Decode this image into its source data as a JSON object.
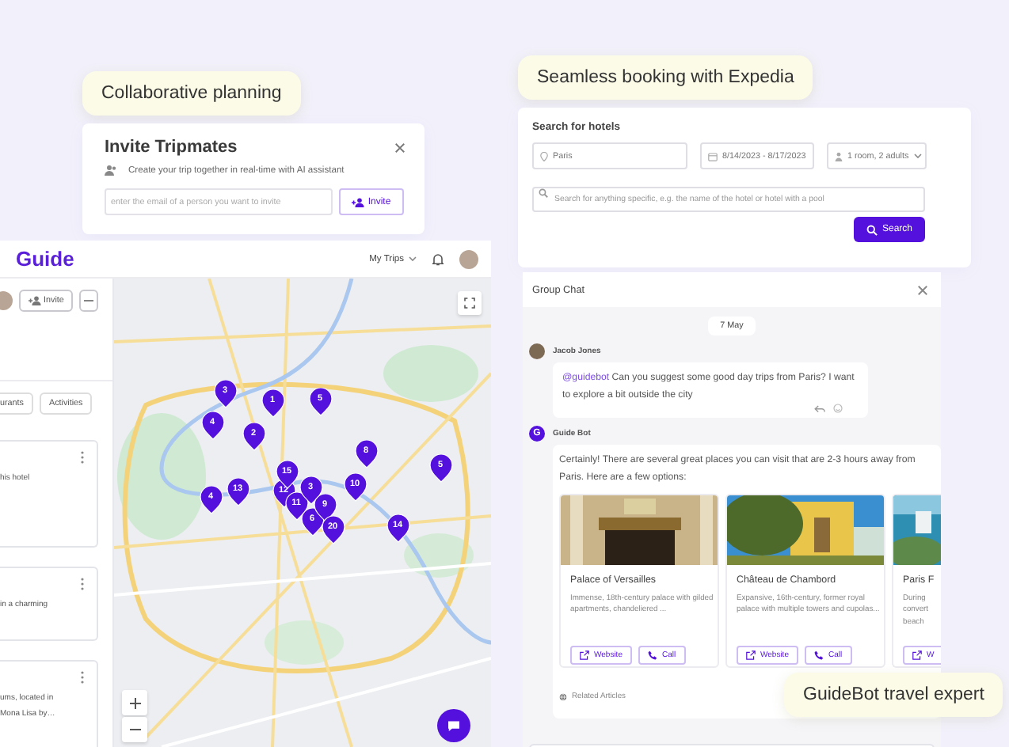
{
  "captions": [
    {
      "text": "Collaborative planning"
    },
    {
      "text": "Seamless booking with Expedia"
    },
    {
      "text": "GuideBot travel expert"
    }
  ],
  "invite": {
    "title": "Invite Tripmates",
    "subtitle": "Create your trip together in real-time with AI assistant",
    "email": {
      "placeholder": "enter the email of a person you want to invite"
    },
    "button": "Invite"
  },
  "app": {
    "logo": "Guide",
    "trips_menu": "My Trips",
    "sidebar": {
      "invite_button": "Invite",
      "tabs": [
        {
          "label": "urants",
          "selected": false
        },
        {
          "label": "Activities",
          "selected": false
        }
      ],
      "cards": [
        {
          "lines": [
            "his hotel"
          ]
        },
        {
          "lines": [
            "in a charming"
          ]
        },
        {
          "lines": [
            "ums, located in",
            "Mona Lisa by…"
          ]
        }
      ]
    },
    "map": {
      "pins": [
        {
          "label": "3"
        },
        {
          "label": "1"
        },
        {
          "label": "5"
        },
        {
          "label": "4"
        },
        {
          "label": "2"
        },
        {
          "label": "8"
        },
        {
          "label": "5"
        },
        {
          "label": "12"
        },
        {
          "label": "11"
        },
        {
          "label": "6"
        },
        {
          "label": "15"
        },
        {
          "label": "3"
        },
        {
          "label": "10"
        },
        {
          "label": "4"
        },
        {
          "label": "13"
        },
        {
          "label": "9"
        },
        {
          "label": "20"
        },
        {
          "label": "14"
        }
      ]
    }
  },
  "hotels": {
    "title": "Search for hotels",
    "destination": "Paris",
    "dates": "8/14/2023 - 8/17/2023",
    "guests": "1 room, 2 adults",
    "query": {
      "placeholder": "Search for anything specific, e.g. the name of the hotel or hotel with a pool"
    },
    "button": "Search"
  },
  "chat": {
    "title": "Group Chat",
    "date": "7 May",
    "messages": [
      {
        "kind": "user",
        "author": "Jacob Jones",
        "mention": "@guidebot",
        "text": "Can you suggest some good day trips from Paris? I want to explore a bit outside the city"
      },
      {
        "kind": "bot",
        "author": "Guide Bot",
        "avatar": "G",
        "text": "Certainly! There are several great places you can visit that are 2-3 hours away from Paris. Here are a few options:",
        "footer": "Related Articles",
        "places": [
          {
            "title": "Palace of Versailles",
            "description": "Immense, 18th-century palace with gilded apartments, chandeliered ...",
            "buttons": [
              {
                "kind": "website",
                "label": "Website"
              },
              {
                "kind": "call",
                "label": "Call"
              }
            ]
          },
          {
            "title": "Château de Chambord",
            "description": "Expansive, 16th-century, former royal palace with multiple towers and cupolas...",
            "buttons": [
              {
                "kind": "website",
                "label": "Website"
              },
              {
                "kind": "call",
                "label": "Call"
              }
            ]
          },
          {
            "title": "Paris F",
            "description": "During convert beach",
            "buttons": [
              {
                "kind": "website",
                "label": "W"
              }
            ]
          }
        ]
      }
    ]
  }
}
